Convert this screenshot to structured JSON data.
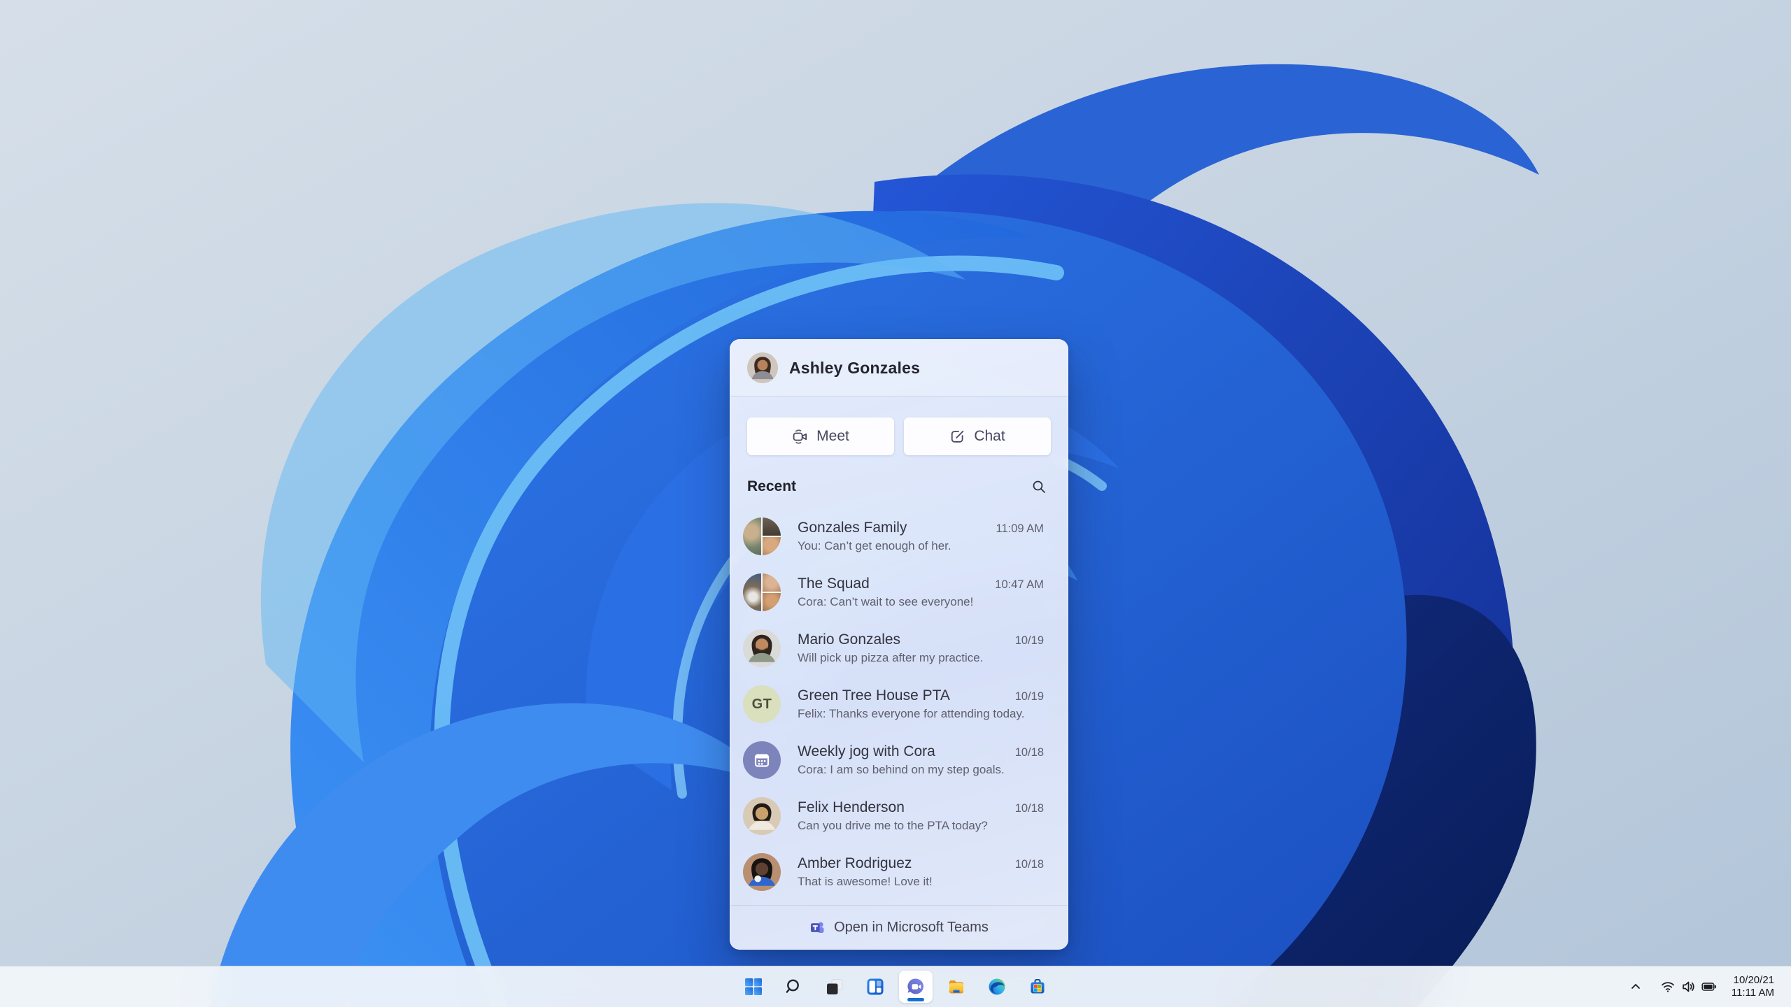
{
  "panel": {
    "profile": {
      "name": "Ashley Gonzales",
      "avatar": "photo-avatar"
    },
    "actions": {
      "meet": "Meet",
      "meet_icon": "video-camera-icon",
      "chat": "Chat",
      "chat_icon": "compose-icon"
    },
    "recent": {
      "title": "Recent",
      "search_icon": "search-icon",
      "items": [
        {
          "name": "Gonzales Family",
          "preview": "You: Can’t get enough of her.",
          "time": "11:09 AM",
          "avatar": "group-photo-collage"
        },
        {
          "name": "The Squad",
          "preview": "Cora: Can’t wait to see everyone!",
          "time": "10:47 AM",
          "avatar": "group-photo-collage"
        },
        {
          "name": "Mario Gonzales",
          "preview": "Will pick up pizza after my practice.",
          "time": "10/19",
          "avatar": "photo-avatar"
        },
        {
          "name": "Green Tree House PTA",
          "preview": "Felix: Thanks everyone for attending today.",
          "time": "10/19",
          "avatar": "initials-avatar",
          "initials": "GT"
        },
        {
          "name": "Weekly jog with Cora",
          "preview": "Cora: I am so behind on my step goals.",
          "time": "10/18",
          "avatar": "calendar-icon-avatar"
        },
        {
          "name": "Felix Henderson",
          "preview": "Can you drive me to the PTA today?",
          "time": "10/18",
          "avatar": "photo-avatar"
        },
        {
          "name": "Amber Rodriguez",
          "preview": "That is awesome! Love it!",
          "time": "10/18",
          "avatar": "photo-avatar"
        }
      ]
    },
    "footer": {
      "label": "Open in Microsoft Teams",
      "icon": "microsoft-teams-icon"
    }
  },
  "taskbar": {
    "icons": [
      "start-icon",
      "search-icon",
      "task-view-icon",
      "widgets-icon",
      "teams-chat-icon",
      "file-explorer-icon",
      "edge-icon",
      "microsoft-store-icon"
    ],
    "active_icon": "teams-chat-icon",
    "tray": {
      "icons": [
        "hidden-icons-chevron-icon",
        "wifi-icon",
        "volume-icon",
        "battery-icon"
      ],
      "date": "10/20/21",
      "time": "11:11 AM"
    }
  },
  "colors": {
    "accent": "#1570cf",
    "teams_purple": "#5059c9",
    "teams_light_purple": "#7b83eb",
    "taskbar_bg": "#f1f5fa",
    "panel_text": "#30303c",
    "muted_text": "#60606e",
    "wallpaper_bg_light": "#d3dde8",
    "wallpaper_blue": "#2e78ea",
    "wallpaper_navy": "#0c2470"
  }
}
